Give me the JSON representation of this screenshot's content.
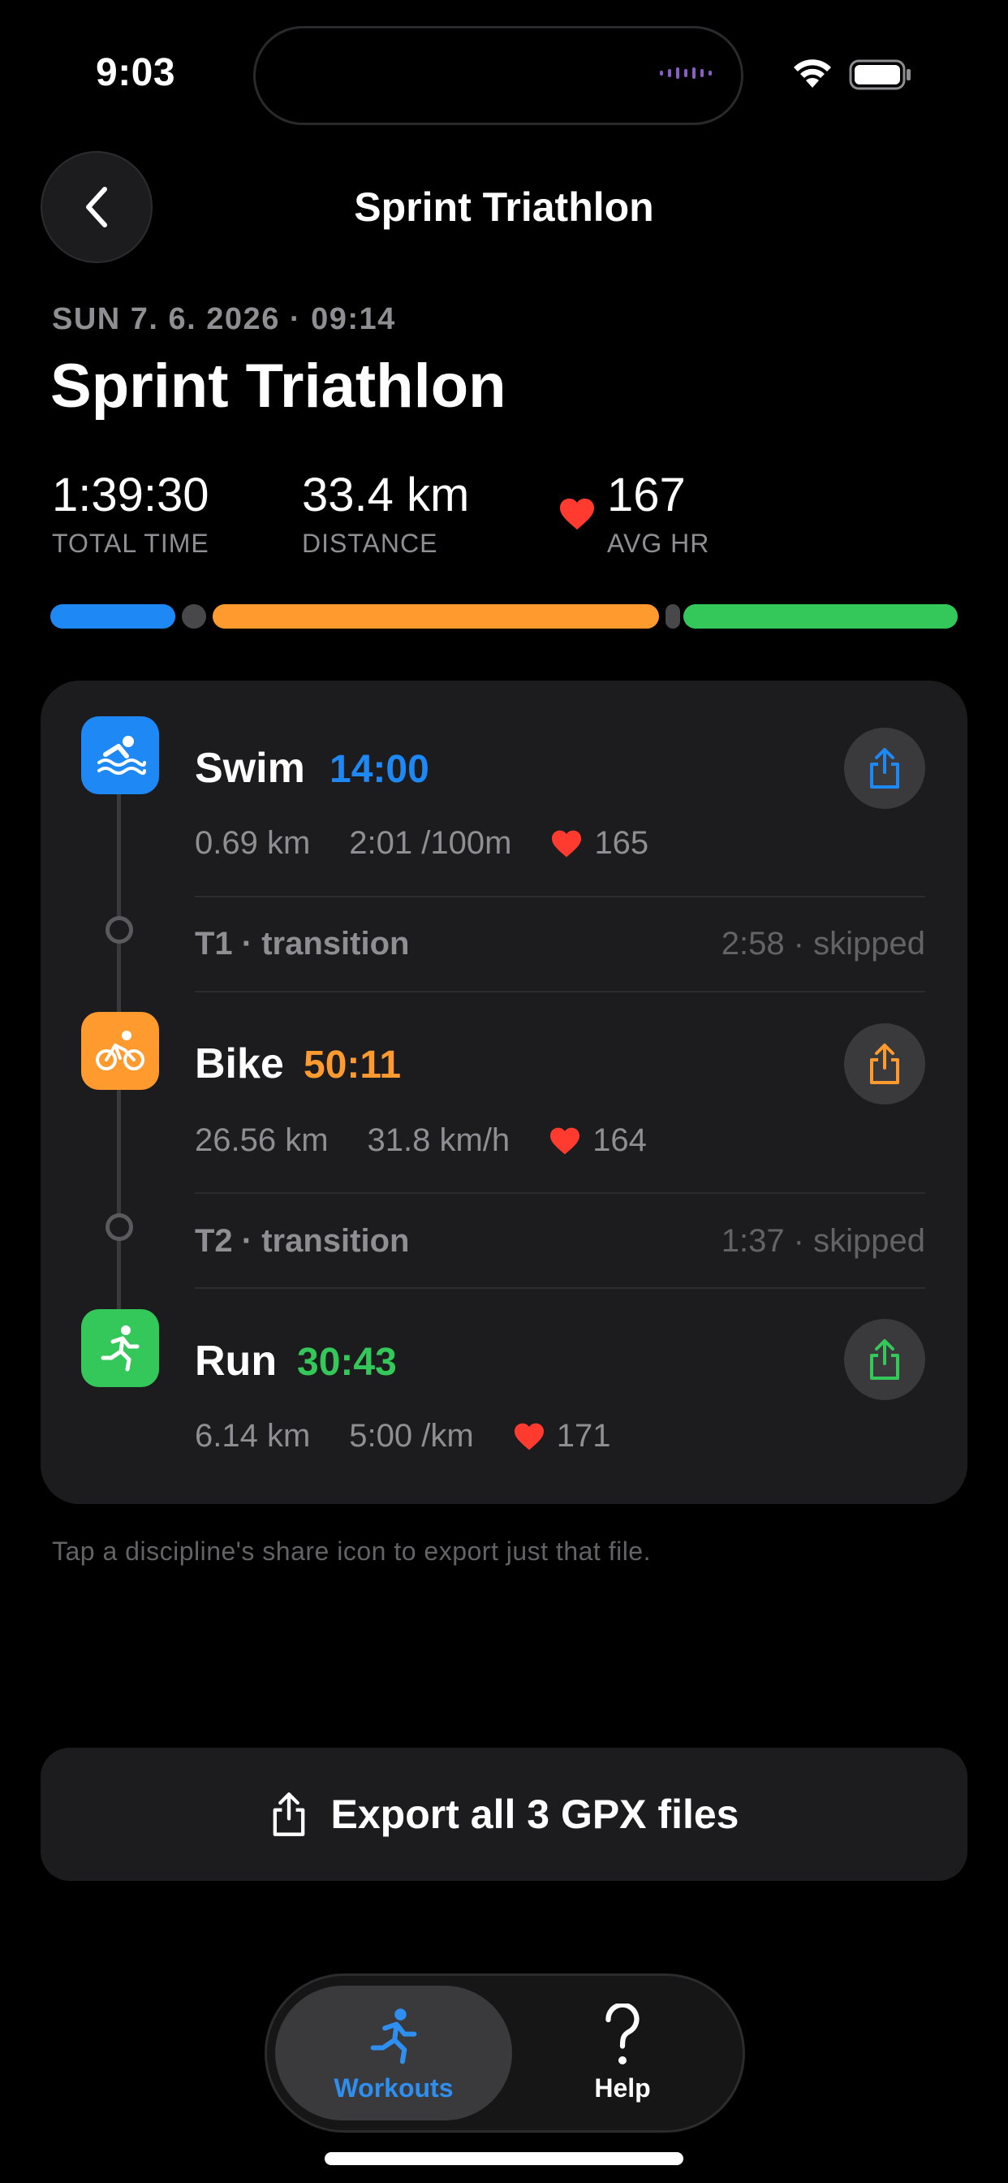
{
  "status_bar": {
    "time": "9:03"
  },
  "nav": {
    "title": "Sprint Triathlon",
    "back_icon": "chevron-left-icon"
  },
  "workout": {
    "date": "SUN 7. 6. 2026 · 09:14",
    "title": "Sprint Triathlon",
    "stats": [
      {
        "value": "1:39:30",
        "label": "TOTAL TIME"
      },
      {
        "value": "33.4 km",
        "label": "DISTANCE"
      },
      {
        "value": "167",
        "label": "AVG HR"
      }
    ]
  },
  "colors": {
    "swim": "#1e88f5",
    "bike": "#ff9a2e",
    "run": "#34c759",
    "heart": "#ff3b30"
  },
  "disciplines": [
    {
      "name": "Swim",
      "time": "14:00",
      "distance": "0.69 km",
      "pace": "2:01 /100m",
      "hr": "165",
      "icon": "swim-icon"
    },
    {
      "name": "Bike",
      "time": "50:11",
      "distance": "26.56 km",
      "pace": "31.8 km/h",
      "hr": "164",
      "icon": "bike-icon"
    },
    {
      "name": "Run",
      "time": "30:43",
      "distance": "6.14 km",
      "pace": "5:00 /km",
      "hr": "171",
      "icon": "run-icon"
    }
  ],
  "transitions": [
    {
      "label": "T1 · transition",
      "detail": "2:58 · skipped"
    },
    {
      "label": "T2 · transition",
      "detail": "1:37 · skipped"
    }
  ],
  "hint": "Tap a discipline's share icon to export just that file.",
  "export": {
    "label": "Export all 3 GPX files"
  },
  "tabs": [
    {
      "label": "Workouts",
      "icon": "run-icon",
      "active": true
    },
    {
      "label": "Help",
      "icon": "question-icon",
      "active": false
    }
  ]
}
